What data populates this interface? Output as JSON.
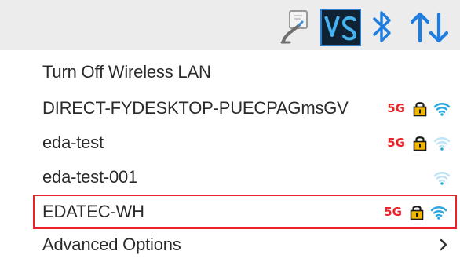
{
  "tray": {
    "icons": [
      "vnc-pen-icon",
      "vnc-viewer-icon",
      "bluetooth-icon",
      "network-arrows-icon"
    ]
  },
  "menu": {
    "items": [
      {
        "label": "Turn Off Wireless LAN"
      },
      {
        "label": "DIRECT-FYDESKTOP-PUECPAGmsGV",
        "band": "5G",
        "secured": true,
        "signal": "full"
      },
      {
        "label": "eda-test",
        "band": "5G",
        "secured": true,
        "signal": "weak"
      },
      {
        "label": "eda-test-001",
        "band": "",
        "secured": false,
        "signal": "weak"
      },
      {
        "label": "EDATEC-WH",
        "band": "5G",
        "secured": true,
        "signal": "full"
      },
      {
        "label": "Advanced Options"
      }
    ]
  },
  "colors": {
    "band_badge": "#e8232a",
    "lock": "#f2b500",
    "wifi_active": "#29a7e1",
    "wifi_weak": "#bfe4f5",
    "highlight_border": "#e8232a"
  }
}
